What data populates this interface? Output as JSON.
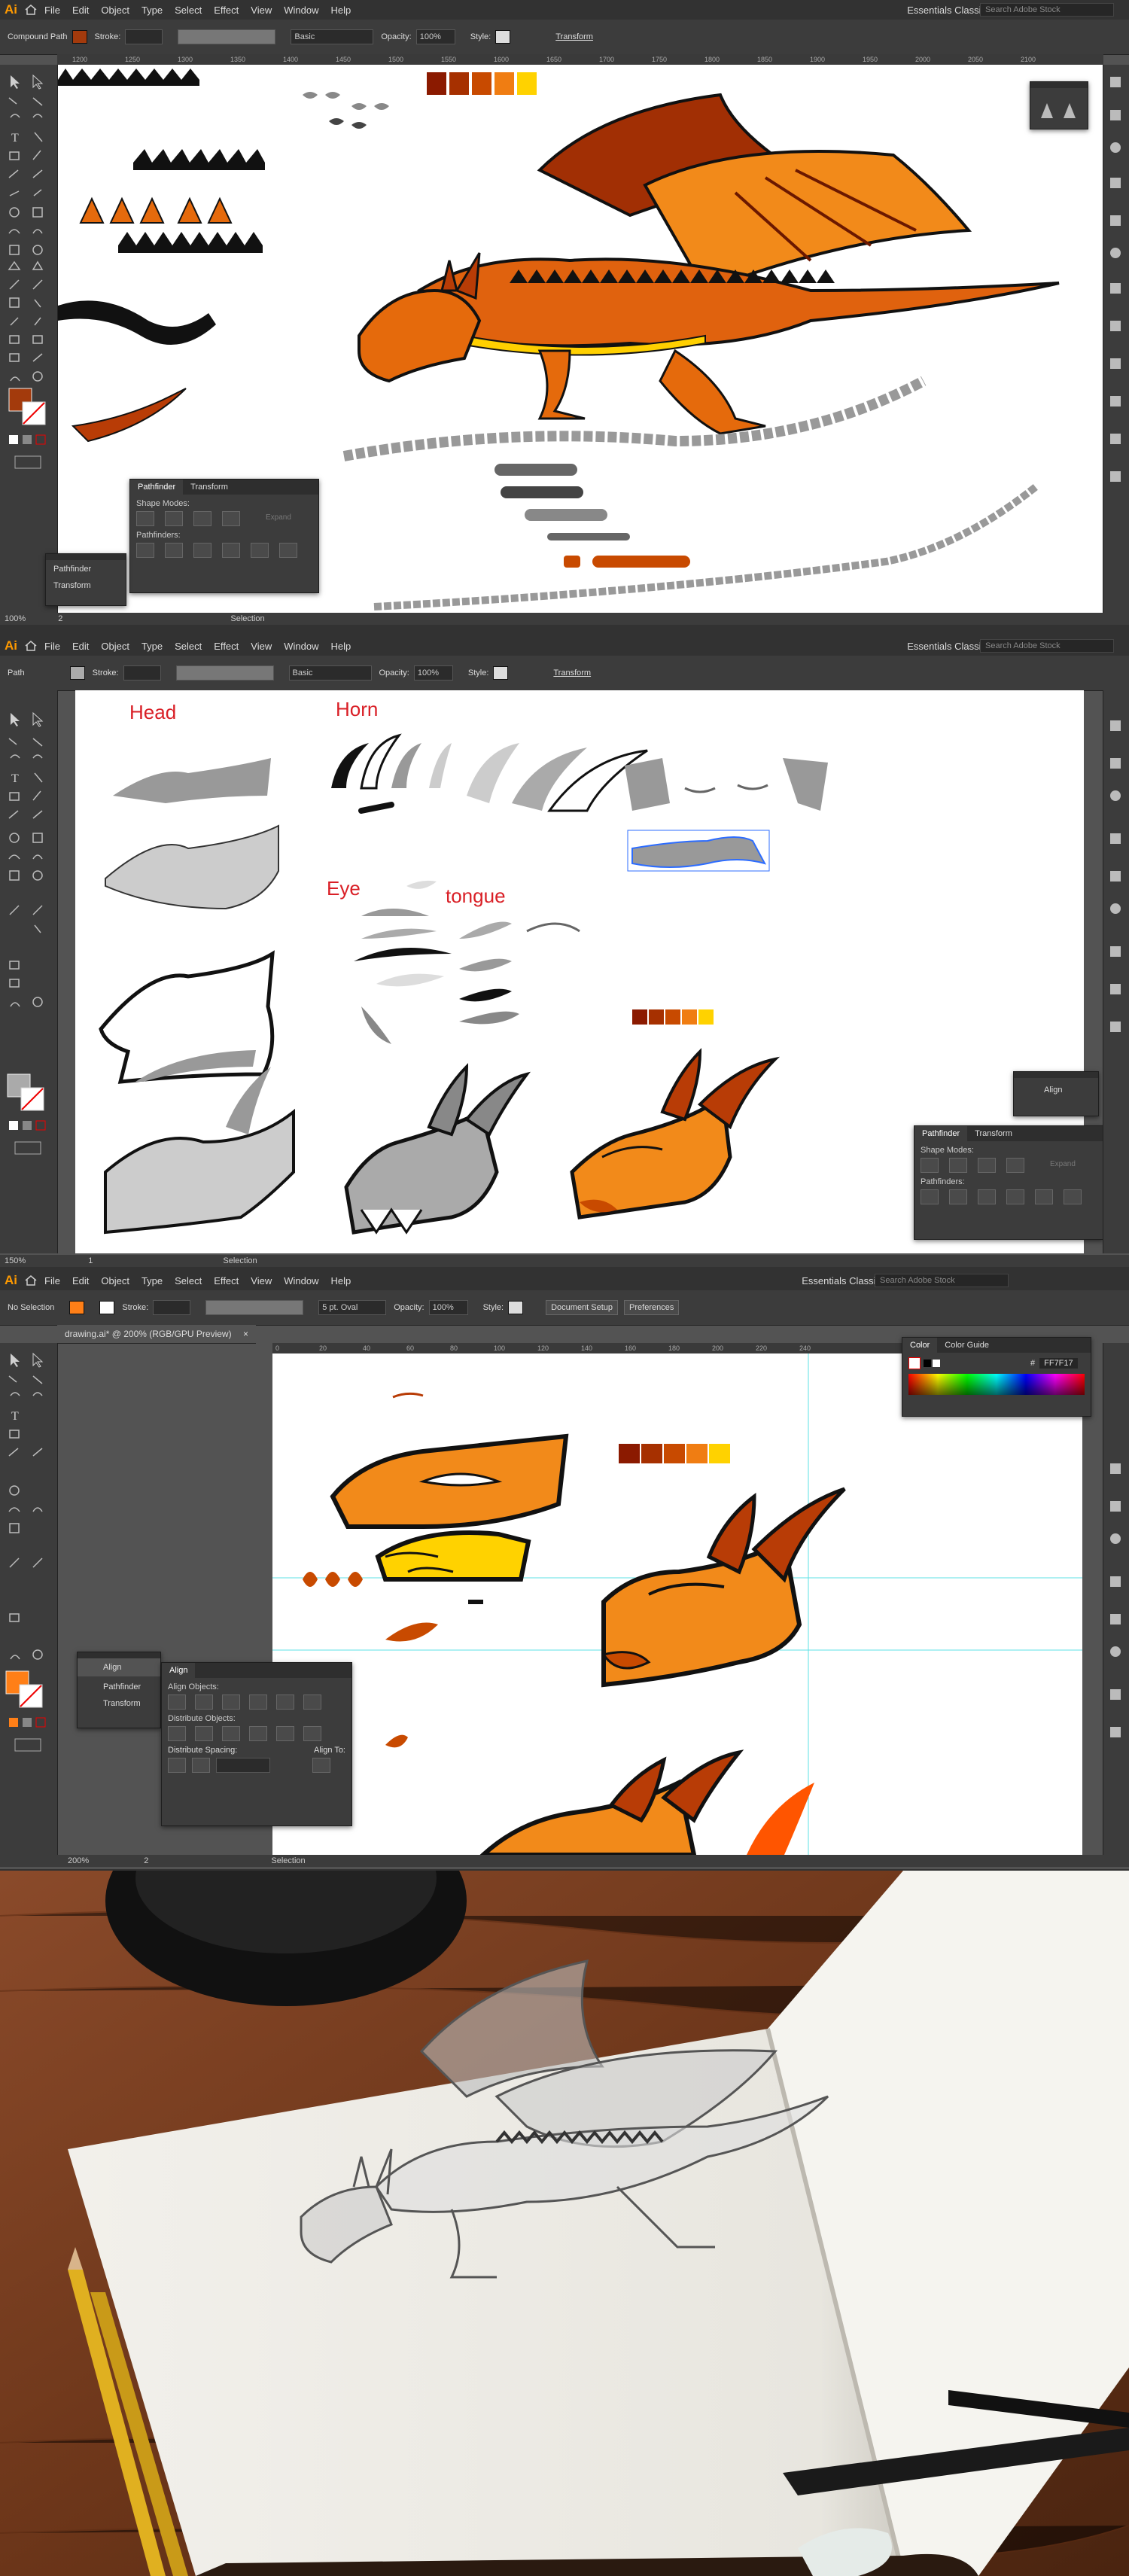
{
  "app": {
    "logo": "Ai",
    "menus": [
      "File",
      "Edit",
      "Object",
      "Type",
      "Select",
      "Effect",
      "View",
      "Window",
      "Help"
    ],
    "workspace": "Essentials Classic",
    "search_placeholder": "Search Adobe Stock"
  },
  "colors": {
    "accent": "#ff9a00",
    "palette": [
      "#8b1a00",
      "#a63000",
      "#c84a00",
      "#f07d12",
      "#ffd200"
    ]
  },
  "screen1": {
    "selection_type": "Compound Path",
    "stroke_label": "Stroke:",
    "stroke_profile": "Basic",
    "opacity_label": "Opacity:",
    "opacity_value": "100%",
    "style_label": "Style:",
    "transform_label": "Transform",
    "zoom": "100%",
    "page": "2",
    "status": "Selection",
    "ruler_ticks": [
      "1200",
      "1250",
      "1300",
      "1350",
      "1400",
      "1450",
      "1500",
      "1550",
      "1600",
      "1650",
      "1700",
      "1750",
      "1800",
      "1850",
      "1900",
      "1950",
      "2000",
      "2050",
      "2100"
    ],
    "pathfinder": {
      "tab1": "Pathfinder",
      "tab2": "Transform",
      "shape_modes": "Shape Modes:",
      "expand": "Expand",
      "pathfinders": "Pathfinders:"
    },
    "mini_panel": {
      "item1": "Pathfinder",
      "item2": "Transform"
    }
  },
  "screen2": {
    "selection_type": "Path",
    "stroke_label": "Stroke:",
    "stroke_profile": "Basic",
    "opacity_label": "Opacity:",
    "opacity_value": "100%",
    "style_label": "Style:",
    "transform_label": "Transform",
    "zoom": "150%",
    "page": "1",
    "status": "Selection",
    "labels": {
      "head": "Head",
      "horn": "Horn",
      "eye": "Eye",
      "tongue": "tongue"
    },
    "align_panel": {
      "title": "Align"
    },
    "pathfinder": {
      "tab1": "Pathfinder",
      "tab2": "Transform",
      "shape_modes": "Shape Modes:",
      "expand": "Expand",
      "pathfinders": "Pathfinders:"
    }
  },
  "screen3": {
    "selection_type": "No Selection",
    "stroke_label": "Stroke:",
    "brush": "5 pt. Oval",
    "opacity_label": "Opacity:",
    "opacity_value": "100%",
    "style_label": "Style:",
    "doc_setup": "Document Setup",
    "preferences": "Preferences",
    "doc_tab": "drawing.ai* @ 200% (RGB/GPU Preview)",
    "zoom": "200%",
    "page": "2",
    "status": "Selection",
    "ruler_ticks": [
      "0",
      "20",
      "40",
      "60",
      "80",
      "100",
      "120",
      "140",
      "160",
      "180",
      "200",
      "220",
      "240"
    ],
    "color_panel": {
      "tab1": "Color",
      "tab2": "Color Guide",
      "hex_label": "#",
      "hex_value": "FF7F17"
    },
    "mini_panel": {
      "item1": "Align",
      "item2": "Pathfinder",
      "item3": "Transform"
    },
    "align": {
      "title": "Align",
      "align_objects": "Align Objects:",
      "distribute_objects": "Distribute Objects:",
      "distribute_spacing": "Distribute Spacing:",
      "align_to": "Align To:"
    }
  }
}
